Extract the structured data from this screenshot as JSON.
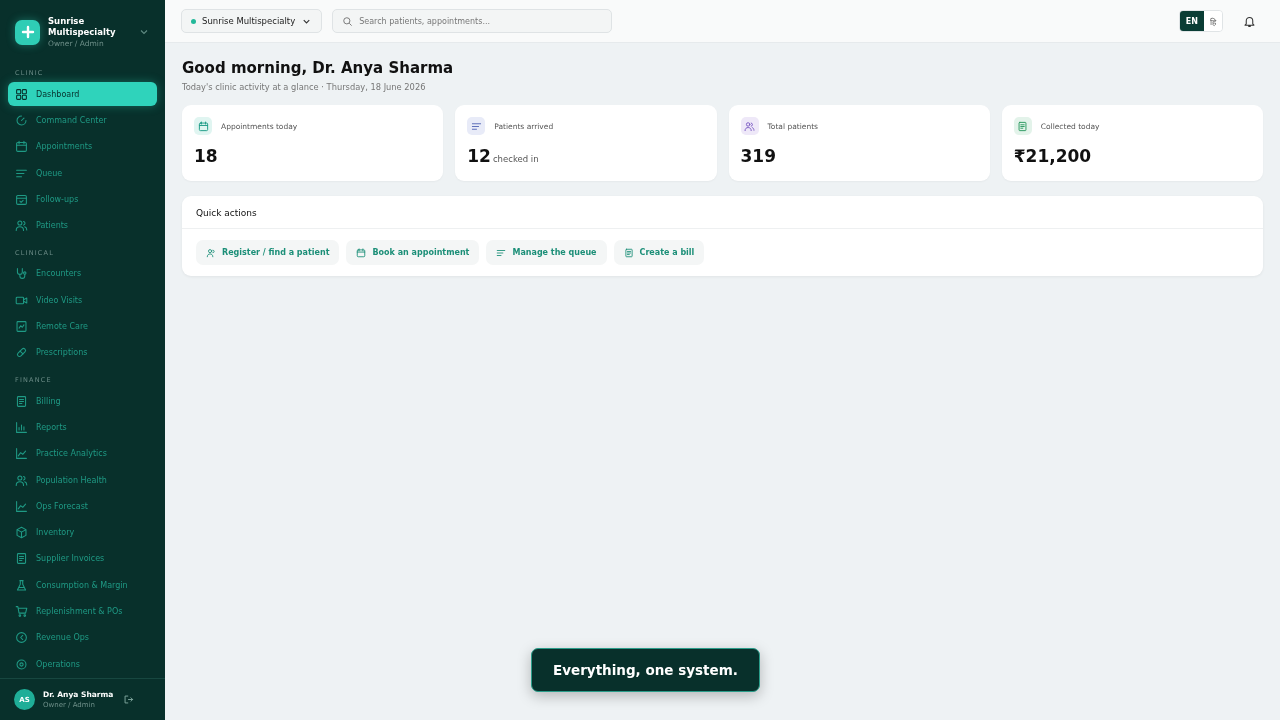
{
  "sidebar": {
    "org_name": "Sunrise Multispecialty",
    "org_role": "Owner / Admin",
    "sections": [
      {
        "title": "CLINIC",
        "items": [
          {
            "label": "Dashboard",
            "selected": true
          },
          {
            "label": "Command Center",
            "selected": false
          },
          {
            "label": "Appointments",
            "selected": false
          },
          {
            "label": "Queue",
            "selected": false
          },
          {
            "label": "Follow-ups",
            "selected": false
          },
          {
            "label": "Patients",
            "selected": false
          }
        ]
      },
      {
        "title": "CLINICAL",
        "items": [
          {
            "label": "Encounters",
            "selected": false
          },
          {
            "label": "Video Visits",
            "selected": false
          },
          {
            "label": "Remote Care",
            "selected": false
          },
          {
            "label": "Prescriptions",
            "selected": false
          }
        ]
      },
      {
        "title": "FINANCE",
        "items": [
          {
            "label": "Billing",
            "selected": false
          },
          {
            "label": "Reports",
            "selected": false
          },
          {
            "label": "Practice Analytics",
            "selected": false
          },
          {
            "label": "Population Health",
            "selected": false
          },
          {
            "label": "Ops Forecast",
            "selected": false
          },
          {
            "label": "Inventory",
            "selected": false
          },
          {
            "label": "Supplier Invoices",
            "selected": false
          },
          {
            "label": "Consumption & Margin",
            "selected": false
          },
          {
            "label": "Replenishment & POs",
            "selected": false
          },
          {
            "label": "Revenue Ops",
            "selected": false
          },
          {
            "label": "Operations",
            "selected": false
          }
        ]
      }
    ],
    "user": {
      "initials": "AS",
      "name": "Dr. Anya Sharma",
      "role": "Owner / Admin"
    }
  },
  "topbar": {
    "clinic_selector": "Sunrise Multispecialty",
    "search": {
      "placeholder": "Search patients, appointments..."
    },
    "languages": [
      {
        "label": "EN",
        "selected": true
      },
      {
        "label": "हि",
        "selected": false
      }
    ]
  },
  "greeting": {
    "title": "Good morning, Dr. Anya Sharma",
    "subtitle": "Today's clinic activity at a glance · Thursday, 18 June 2026"
  },
  "stats": [
    {
      "label": "Appointments today",
      "value": "18",
      "color": "#e0f5f1"
    },
    {
      "label": "Patients arrived",
      "value": "12",
      "unit": "checked in",
      "color": "#e8ebf8"
    },
    {
      "label": "Total patients",
      "value": "319",
      "color": "#eee8f8"
    },
    {
      "label": "Collected today",
      "value": "₹21,200",
      "color": "#e3f3ea"
    }
  ],
  "quick_actions": {
    "title": "Quick actions",
    "actions": [
      "Register / find a patient",
      "Book an appointment",
      "Manage the queue",
      "Create a bill"
    ]
  },
  "toast": "Everything, one system."
}
